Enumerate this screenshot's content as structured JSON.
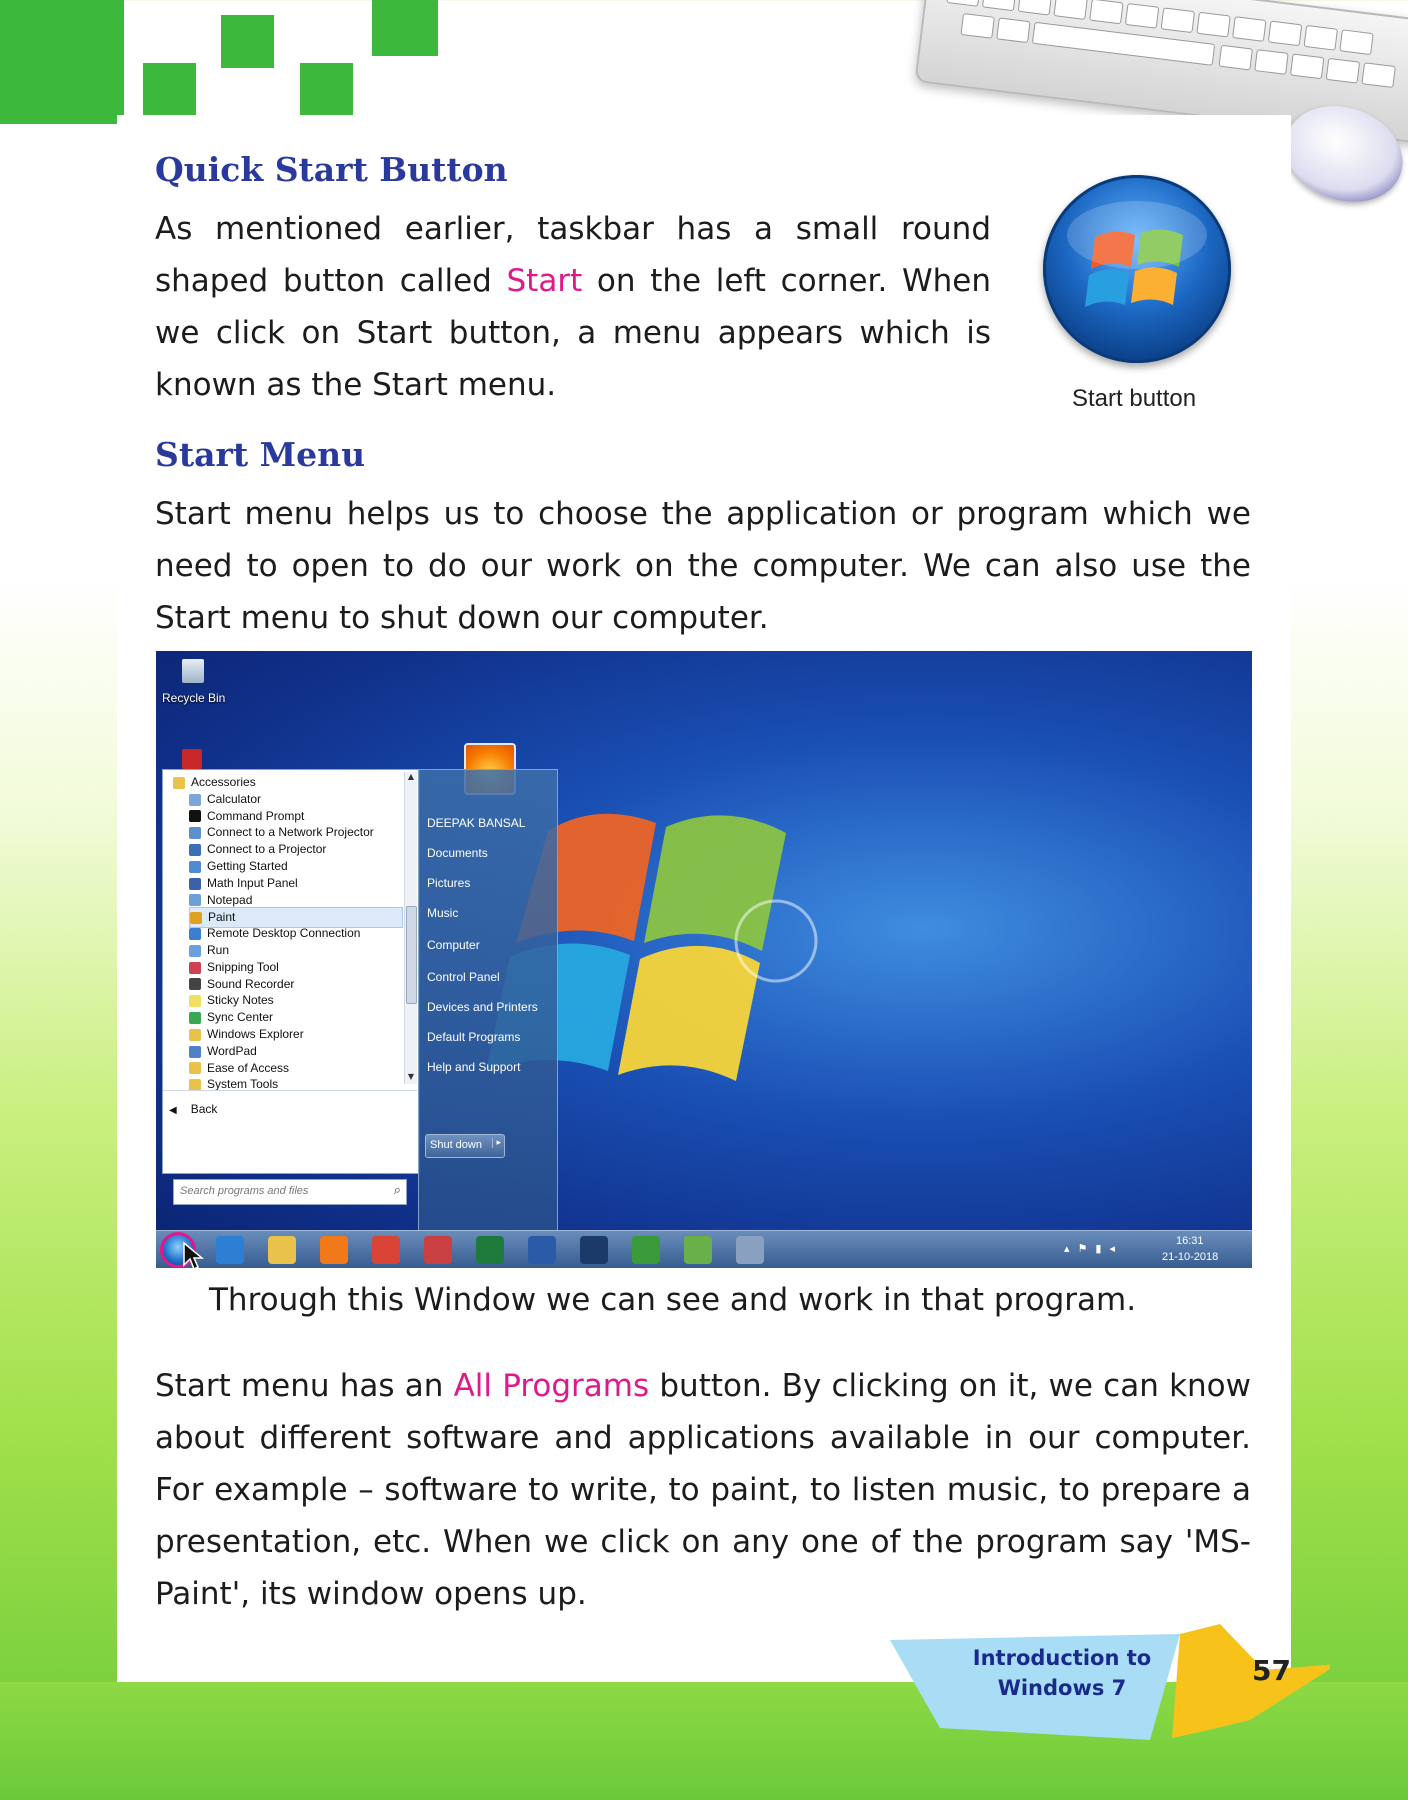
{
  "sections": [
    {
      "heading": "Quick Start Button",
      "paragraph": {
        "before": "As mentioned earlier, taskbar has a small round shaped button called ",
        "highlight": "Start",
        "after": " on the left corner. When we click on Start button, a menu appears which is known as the Start menu."
      }
    },
    {
      "heading": "Start Menu",
      "paragraph": "Start menu helps us to choose the application or program which we need to open to do our work on the computer. We can also use the Start menu to shut down our computer."
    }
  ],
  "figure_caption": "Start button",
  "screenshot": {
    "desktop_icon": "Recycle Bin",
    "programs": [
      {
        "label": "Accessories",
        "icon": "folder-icon",
        "color": "#e8c24a",
        "level": 0
      },
      {
        "label": "Calculator",
        "icon": "calculator-icon",
        "color": "#7aa6d8",
        "level": 1
      },
      {
        "label": "Command Prompt",
        "icon": "terminal-icon",
        "color": "#111111",
        "level": 1
      },
      {
        "label": "Connect to a Network Projector",
        "icon": "projector-icon",
        "color": "#5a8fd0",
        "level": 1
      },
      {
        "label": "Connect to a Projector",
        "icon": "projector-icon",
        "color": "#3c6fb8",
        "level": 1
      },
      {
        "label": "Getting Started",
        "icon": "start-icon",
        "color": "#4f8bd3",
        "level": 1
      },
      {
        "label": "Math Input Panel",
        "icon": "pen-icon",
        "color": "#3b62a8",
        "level": 1
      },
      {
        "label": "Notepad",
        "icon": "notepad-icon",
        "color": "#6ea0d8",
        "level": 1
      },
      {
        "label": "Paint",
        "icon": "paint-icon",
        "color": "#e0a020",
        "level": 1
      },
      {
        "label": "Remote Desktop Connection",
        "icon": "remote-icon",
        "color": "#3a7fcf",
        "level": 1
      },
      {
        "label": "Run",
        "icon": "run-icon",
        "color": "#6aa0e0",
        "level": 1
      },
      {
        "label": "Snipping Tool",
        "icon": "scissors-icon",
        "color": "#d04050",
        "level": 1
      },
      {
        "label": "Sound Recorder",
        "icon": "microphone-icon",
        "color": "#444444",
        "level": 1
      },
      {
        "label": "Sticky Notes",
        "icon": "note-icon",
        "color": "#f0e060",
        "level": 1
      },
      {
        "label": "Sync Center",
        "icon": "sync-icon",
        "color": "#3aa850",
        "level": 1
      },
      {
        "label": "Windows Explorer",
        "icon": "folder-icon",
        "color": "#e8c24a",
        "level": 1
      },
      {
        "label": "WordPad",
        "icon": "wordpad-icon",
        "color": "#4f80c8",
        "level": 1
      },
      {
        "label": "Ease of Access",
        "icon": "folder-icon",
        "color": "#e8c24a",
        "level": 1
      },
      {
        "label": "System Tools",
        "icon": "folder-icon",
        "color": "#e8c24a",
        "level": 1
      }
    ],
    "back_label": "Back",
    "search_placeholder": "Search programs and files",
    "right_links": [
      "DEEPAK BANSAL",
      "Documents",
      "Pictures",
      "Music",
      "Computer",
      "Control Panel",
      "Devices and Printers",
      "Default Programs",
      "Help and Support"
    ],
    "shutdown_label": "Shut down",
    "clock_time": "16:31",
    "clock_date": "21-10-2018",
    "taskbar_icons": [
      {
        "name": "ie-icon",
        "color": "#2d7fd3"
      },
      {
        "name": "explorer-icon",
        "color": "#e8c24a"
      },
      {
        "name": "media-player-icon",
        "color": "#f07a1a"
      },
      {
        "name": "chrome-icon",
        "color": "#d94436"
      },
      {
        "name": "app-icon",
        "color": "#c84040"
      },
      {
        "name": "excel-icon",
        "color": "#1e7a3a"
      },
      {
        "name": "word-icon",
        "color": "#2a5aa8"
      },
      {
        "name": "photoshop-icon",
        "color": "#1b3a6a"
      },
      {
        "name": "paint-tool-icon",
        "color": "#3a9a3a"
      },
      {
        "name": "notes-icon",
        "color": "#6ab04a"
      },
      {
        "name": "tool-icon",
        "color": "#8aa0c0"
      }
    ]
  },
  "window_caption": "Through this Window we can see and work in that program.",
  "paragraph3": {
    "before": "Start menu has an ",
    "highlight": "All Programs",
    "after": " button. By clicking on it, we can know about different software and applications available in our computer. For example – software to write, to paint, to listen music, to prepare a presentation, etc. When we click on any one of the program say 'MS-Paint', its window opens up."
  },
  "footer": {
    "chapter_line1": "Introduction to",
    "chapter_line2": "Windows 7",
    "page_number": "57"
  },
  "colors": {
    "heading": "#2a3a9c",
    "highlight": "#e0188c",
    "green": "#3cb83c"
  }
}
